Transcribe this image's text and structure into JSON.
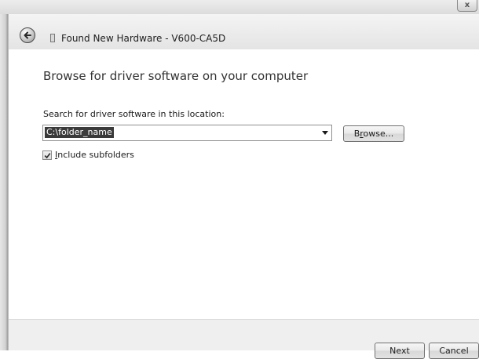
{
  "window": {
    "title": "Found New Hardware - V600-CA5D",
    "close_label": "x"
  },
  "header": {
    "heading": "Browse for driver software on your computer"
  },
  "search": {
    "label": "Search for driver software in this location:",
    "value": "C:\\folder_name"
  },
  "buttons": {
    "browse_prefix": "B",
    "browse_accel": "r",
    "browse_suffix": "owse...",
    "next": "Next",
    "cancel": "Cancel"
  },
  "options": {
    "include_subfolders_accel": "I",
    "include_subfolders_rest": "nclude subfolders",
    "include_subfolders_checked": true
  },
  "icons": {
    "back": "back-arrow-icon",
    "device": "usb-device-icon",
    "checkmark": "checkmark-icon"
  },
  "colors": {
    "selection": "#3a3a3a",
    "footer": "#efefef"
  }
}
